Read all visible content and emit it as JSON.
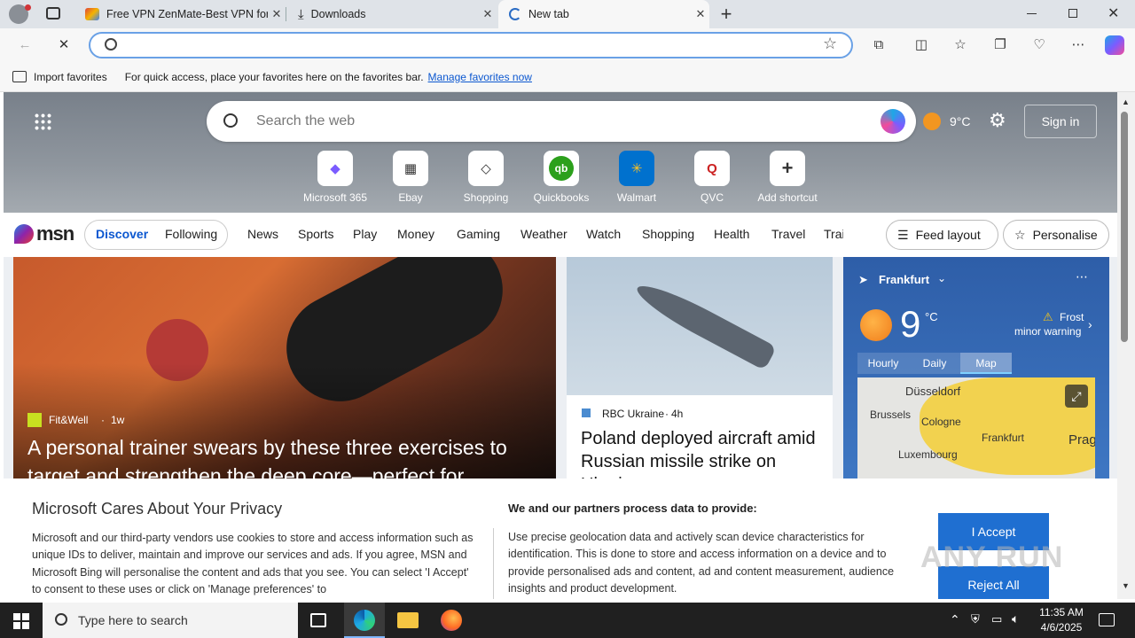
{
  "tabs": [
    {
      "title": "Free VPN ZenMate-Best VPN for"
    },
    {
      "title": "Downloads"
    },
    {
      "title": "New tab"
    }
  ],
  "favbar": {
    "import": "Import favorites",
    "hint": "For quick access, place your favorites here on the favorites bar.",
    "manage": "Manage favorites now"
  },
  "msn": {
    "search_placeholder": "Search the web",
    "weather_temp": "9°C",
    "sign_in": "Sign in",
    "shortcuts": [
      "Microsoft 365",
      "Ebay",
      "Shopping",
      "Quickbooks",
      "Walmart",
      "QVC",
      "Add shortcut"
    ],
    "logo": "msn",
    "toggle": [
      "Discover",
      "Following"
    ],
    "nav": [
      "News",
      "Sports",
      "Play",
      "Money",
      "Gaming",
      "Weather",
      "Watch",
      "Shopping",
      "Health",
      "Travel",
      "Trai"
    ],
    "feed_layout": "Feed layout",
    "personalise": "Personalise"
  },
  "card1": {
    "source": "Fit&Well",
    "age": "1w",
    "headline": "A personal trainer swears by these three exercises to target and strengthen the deep core—perfect for"
  },
  "card2": {
    "source": "RBC Ukraine",
    "age": "4h",
    "headline": "Poland deployed aircraft amid Russian missile strike on Ukraine"
  },
  "weather": {
    "city": "Frankfurt",
    "temp": "9",
    "unit": "°C",
    "warn_title": "Frost",
    "warn_sub": "minor warning",
    "tabs": [
      "Hourly",
      "Daily",
      "Map"
    ],
    "map_labels": [
      "Düsseldorf",
      "Brussels",
      "Cologne",
      "Frankfurt",
      "Luxembourg",
      "Prag"
    ]
  },
  "privacy": {
    "title": "Microsoft Cares About Your Privacy",
    "body": "Microsoft and our third-party vendors use cookies to store and access information such as unique IDs to deliver, maintain and improve our services and ads. If you agree, MSN and Microsoft Bing will personalise the content and ads that you see. You can select 'I Accept' to consent to these uses or click on 'Manage preferences' to",
    "sub_title": "We and our partners process data to provide:",
    "sub_body": "Use precise geolocation data and actively scan device characteristics for identification. This is done to store and access information on a device and to provide personalised ads and content, ad and content measurement, audience insights and product development.",
    "accept": "I Accept",
    "reject": "Reject All"
  },
  "watermark": "ANY RUN",
  "taskbar": {
    "search": "Type here to search",
    "time": "11:35 AM",
    "date": "4/6/2025"
  }
}
